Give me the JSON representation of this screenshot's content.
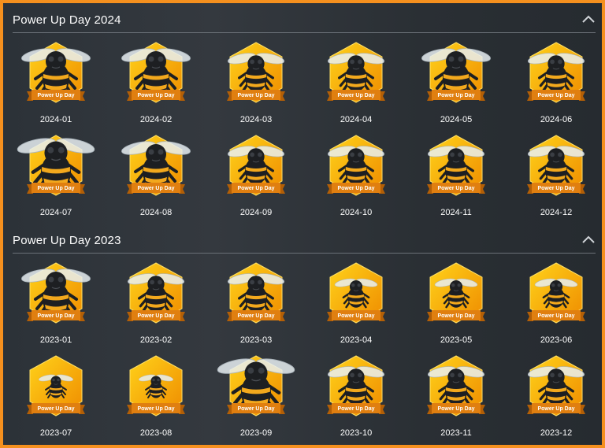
{
  "sections": [
    {
      "title": "Power Up Day 2024",
      "badges": [
        {
          "label": "2024-01",
          "ribbon": "Power Up Day",
          "size": "large"
        },
        {
          "label": "2024-02",
          "ribbon": "Power Up Day",
          "size": "large"
        },
        {
          "label": "2024-03",
          "ribbon": "Power Up Day",
          "size": "medium"
        },
        {
          "label": "2024-04",
          "ribbon": "Power Up Day",
          "size": "medium"
        },
        {
          "label": "2024-05",
          "ribbon": "Power Up Day",
          "size": "large"
        },
        {
          "label": "2024-06",
          "ribbon": "Power Up Day",
          "size": "medium"
        },
        {
          "label": "2024-07",
          "ribbon": "Power Up Day",
          "size": "xlarge"
        },
        {
          "label": "2024-08",
          "ribbon": "Power Up Day",
          "size": "large"
        },
        {
          "label": "2024-09",
          "ribbon": "Power Up Day",
          "size": "medium"
        },
        {
          "label": "2024-10",
          "ribbon": "Power Up Day",
          "size": "medium"
        },
        {
          "label": "2024-11",
          "ribbon": "Power Up Day",
          "size": "medium"
        },
        {
          "label": "2024-12",
          "ribbon": "Power Up Day",
          "size": "medium"
        }
      ]
    },
    {
      "title": "Power Up Day 2023",
      "badges": [
        {
          "label": "2023-01",
          "ribbon": "Power Up Day",
          "size": "large"
        },
        {
          "label": "2023-02",
          "ribbon": "Power Up Day",
          "size": "medium"
        },
        {
          "label": "2023-03",
          "ribbon": "Power Up Day",
          "size": "medium"
        },
        {
          "label": "2023-04",
          "ribbon": "Power Up Day",
          "size": "small"
        },
        {
          "label": "2023-05",
          "ribbon": "Power Up Day",
          "size": "small"
        },
        {
          "label": "2023-06",
          "ribbon": "Power Up Day",
          "size": "small"
        },
        {
          "label": "2023-07",
          "ribbon": "Power Up Day",
          "size": "tiny"
        },
        {
          "label": "2023-08",
          "ribbon": "Power Up Day",
          "size": "tiny"
        },
        {
          "label": "2023-09",
          "ribbon": "Power Up Day",
          "size": "xlarge"
        },
        {
          "label": "2023-10",
          "ribbon": "Power Up Day",
          "size": "medium"
        },
        {
          "label": "2023-11",
          "ribbon": "Power Up Day",
          "size": "medium"
        },
        {
          "label": "2023-12",
          "ribbon": "Power Up Day",
          "size": "medium"
        }
      ]
    }
  ],
  "colors": {
    "border": "#f5901e",
    "hex_light": "#ffd21a",
    "hex_dark": "#ef8c00",
    "ribbon": "#e07f10",
    "bee_body": "#1d1f22",
    "bee_stripe": "#f2a81d"
  },
  "icons": {
    "collapse": "chevron-up-icon",
    "badge": "bee-hexagon-badge-icon"
  }
}
